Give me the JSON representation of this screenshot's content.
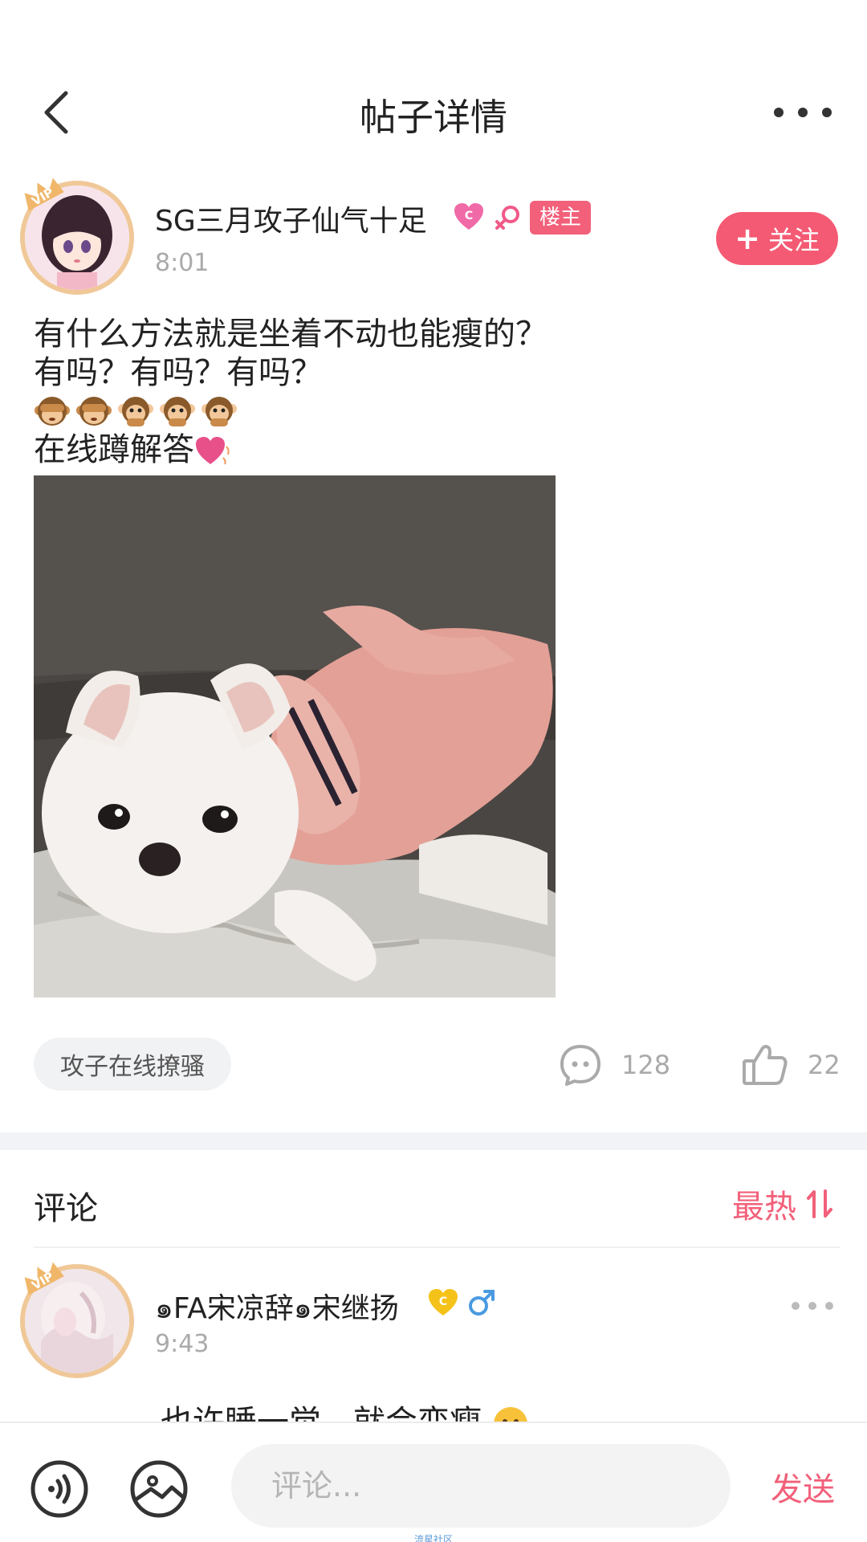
{
  "header": {
    "title": "帖子详情"
  },
  "post": {
    "author": {
      "name": "SG三月攻子仙气十足",
      "owner_badge": "楼主",
      "time": "8:01",
      "vip_label": "VIP",
      "level_badge": "C"
    },
    "follow_label": "关注",
    "text_lines": [
      "有什么方法就是坐着不动也能瘦的？",
      "有吗？有吗？有吗？",
      "在线蹲解答"
    ],
    "tag": "攻子在线撩骚",
    "comment_count": "128",
    "like_count": "22"
  },
  "comments_section": {
    "title": "评论",
    "sort_label": "最热"
  },
  "comment": {
    "author": {
      "name": "๑FA宋凉辞๑宋继扬",
      "time": "9:43",
      "vip_label": "VIP",
      "level_badge": "C"
    },
    "text": "也许睡一觉，就会变瘦"
  },
  "bottom_bar": {
    "input_placeholder": "评论...",
    "send_label": "发送",
    "watermark": "流星社区"
  },
  "colors": {
    "accent": "#f45a73",
    "badge": "#f2607a",
    "vip_ring": "#f0c898",
    "muted": "#aaaaaa"
  }
}
